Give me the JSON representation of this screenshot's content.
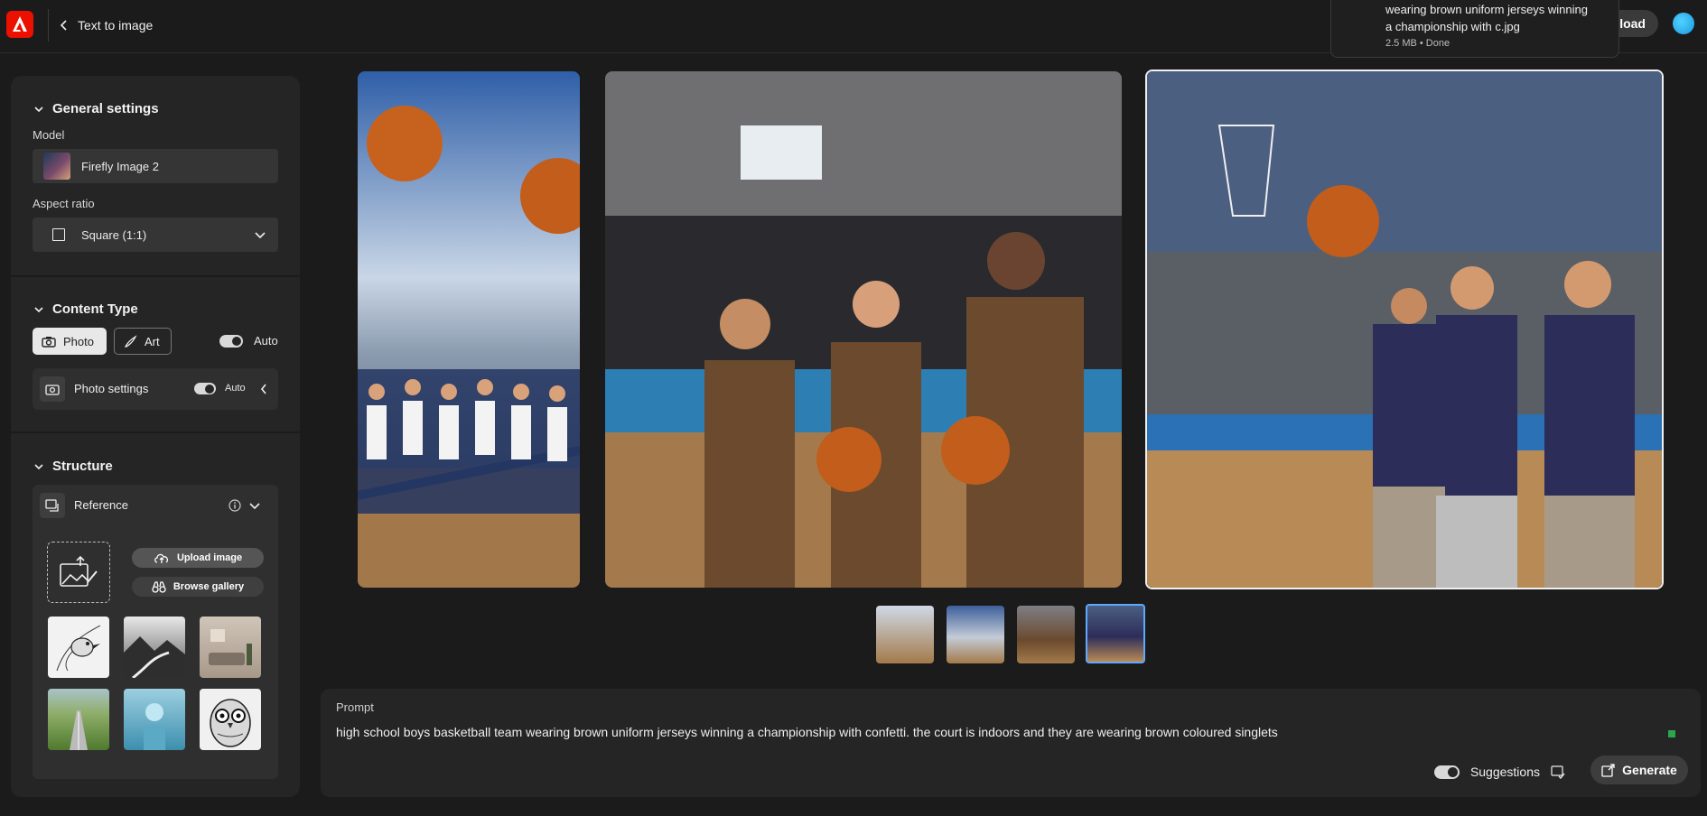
{
  "header": {
    "back_label": "Text to image",
    "download_label": "nload",
    "toast": {
      "line1": "wearing brown uniform jerseys winning",
      "line2": "a championship with c.jpg",
      "status": "2.5 MB • Done"
    }
  },
  "sidebar": {
    "general": {
      "title": "General settings",
      "model_label": "Model",
      "model_value": "Firefly Image 2",
      "aspect_label": "Aspect ratio",
      "aspect_value": "Square (1:1)"
    },
    "content_type": {
      "title": "Content Type",
      "photo_label": "Photo",
      "art_label": "Art",
      "auto_label": "Auto",
      "photo_settings_label": "Photo settings",
      "photo_settings_auto": "Auto"
    },
    "structure": {
      "title": "Structure",
      "reference_label": "Reference",
      "upload_label": "Upload image",
      "browse_label": "Browse gallery",
      "thumbnails": [
        "bird-sketch",
        "mountain-mist",
        "living-room",
        "field-road",
        "sphere-pedestal",
        "owl-sketch"
      ]
    }
  },
  "gallery": {
    "selected_thumbnail": 4,
    "thumbnail_count": 4
  },
  "prompt": {
    "label": "Prompt",
    "text": "high school boys basketball team wearing brown uniform jerseys winning a championship with confetti. the court is indoors and they are wearing brown coloured singlets",
    "suggestions_label": "Suggestions",
    "generate_label": "Generate"
  },
  "colors": {
    "brand": "#eb1000",
    "panel": "#252525",
    "background": "#1b1b1b",
    "selected_outline": "#5ea8ff"
  }
}
